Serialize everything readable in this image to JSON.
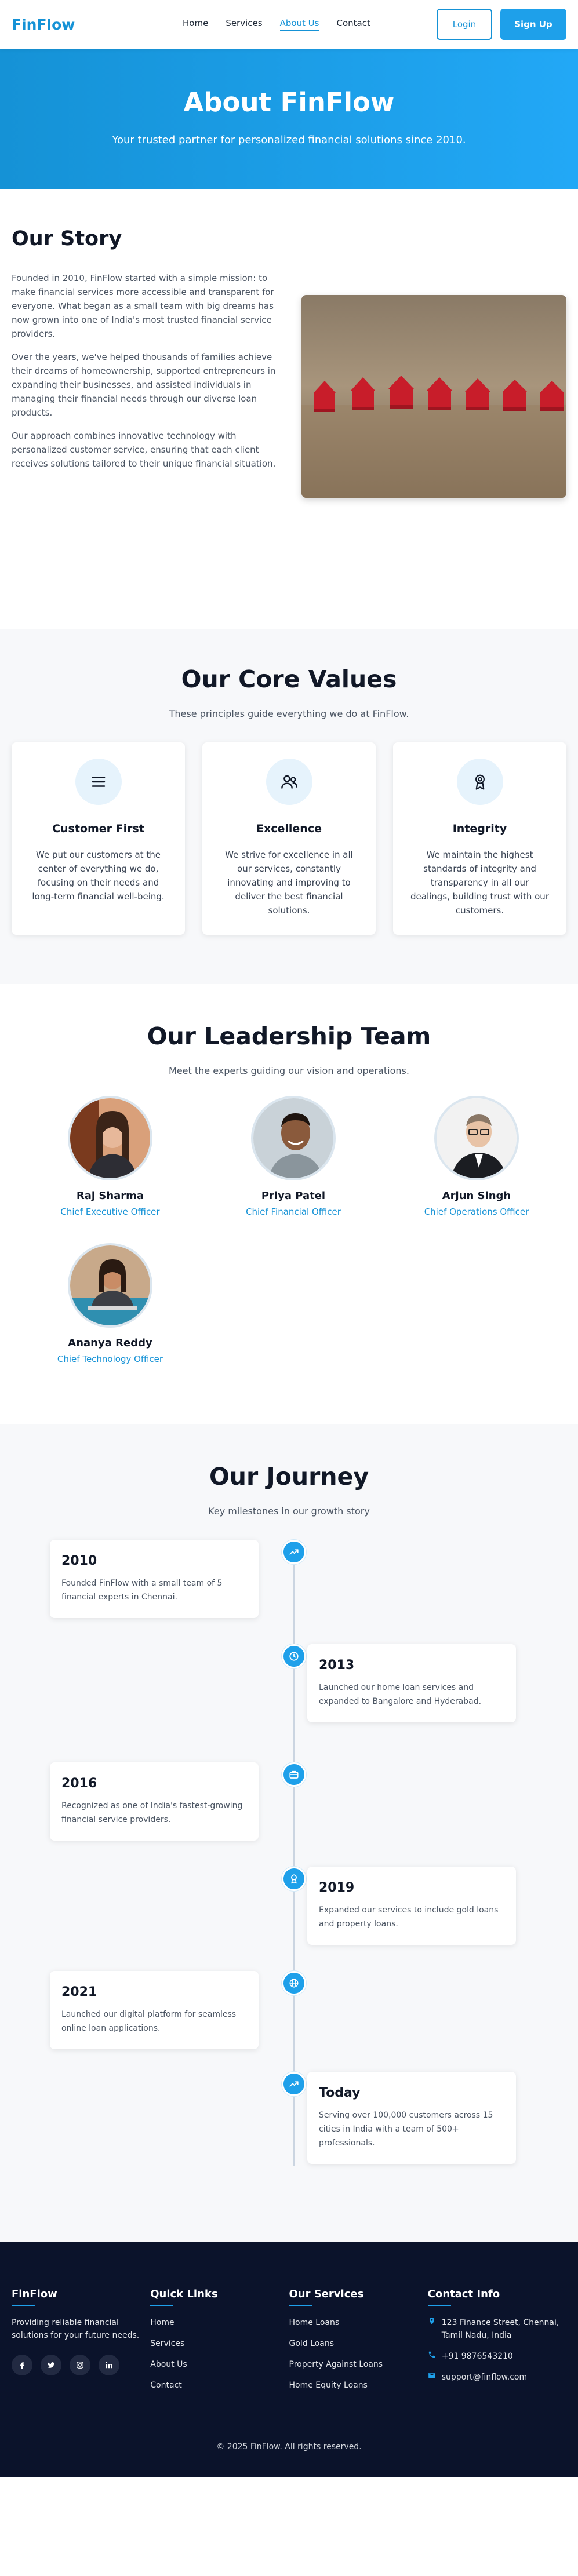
{
  "header": {
    "logo": "FinFlow",
    "nav": [
      "Home",
      "Services",
      "About Us",
      "Contact"
    ],
    "login": "Login",
    "signup": "Sign Up"
  },
  "hero": {
    "title": "About FinFlow",
    "subtitle": "Your trusted partner for personalized financial solutions since 2010."
  },
  "story": {
    "title": "Our Story",
    "paragraphs": [
      "Founded in 2010, FinFlow started with a simple mission: to make financial services more accessible and transparent for everyone. What began as a small team with big dreams has now grown into one of India's most trusted financial service providers.",
      "Over the years, we've helped thousands of families achieve their dreams of homeownership, supported entrepreneurs in expanding their businesses, and assisted individuals in managing their financial needs through our diverse loan products.",
      "Our approach combines innovative technology with personalized customer service, ensuring that each client receives solutions tailored to their unique financial situation."
    ]
  },
  "values": {
    "title": "Our Core Values",
    "subtitle": "These principles guide everything we do at FinFlow.",
    "cards": [
      {
        "icon": "menu-icon",
        "title": "Customer First",
        "text": "We put our customers at the center of everything we do, focusing on their needs and long-term financial well-being."
      },
      {
        "icon": "users-icon",
        "title": "Excellence",
        "text": "We strive for excellence in all our services, constantly innovating and improving to deliver the best financial solutions."
      },
      {
        "icon": "award-icon",
        "title": "Integrity",
        "text": "We maintain the highest standards of integrity and transparency in all our dealings, building trust with our customers."
      }
    ]
  },
  "team": {
    "title": "Our Leadership Team",
    "subtitle": "Meet the experts guiding our vision and operations.",
    "members": [
      {
        "name": "Raj Sharma",
        "role": "Chief Executive Officer"
      },
      {
        "name": "Priya Patel",
        "role": "Chief Financial Officer"
      },
      {
        "name": "Arjun Singh",
        "role": "Chief Operations Officer"
      },
      {
        "name": "Ananya Reddy",
        "role": "Chief Technology Officer"
      }
    ]
  },
  "journey": {
    "title": "Our Journey",
    "subtitle": "Key milestones in our growth story",
    "milestones": [
      {
        "year": "2010",
        "text": "Founded FinFlow with a small team of 5 financial experts in Chennai.",
        "icon": "trend-icon"
      },
      {
        "year": "2013",
        "text": "Launched our home loan services and expanded to Bangalore and Hyderabad.",
        "icon": "clock-icon"
      },
      {
        "year": "2016",
        "text": "Recognized as one of India's fastest-growing financial service providers.",
        "icon": "briefcase-icon"
      },
      {
        "year": "2019",
        "text": "Expanded our services to include gold loans and property loans.",
        "icon": "award-icon"
      },
      {
        "year": "2021",
        "text": "Launched our digital platform for seamless online loan applications.",
        "icon": "globe-icon"
      },
      {
        "year": "Today",
        "text": "Serving over 100,000 customers across 15 cities in India with a team of 500+ professionals.",
        "icon": "trend-icon"
      }
    ]
  },
  "footer": {
    "brand": "FinFlow",
    "tagline": "Providing reliable financial solutions for your future needs.",
    "quick_links_title": "Quick Links",
    "quick_links": [
      "Home",
      "Services",
      "About Us",
      "Contact"
    ],
    "services_title": "Our Services",
    "services": [
      "Home Loans",
      "Gold Loans",
      "Property Against Loans",
      "Home Equity Loans"
    ],
    "contact_title": "Contact Info",
    "address": "123 Finance Street, Chennai, Tamil Nadu, India",
    "phone": "+91 9876543210",
    "email": "support@finflow.com",
    "copyright": "© 2025 FinFlow. All rights reserved."
  },
  "colors": {
    "primary": "#1592d6",
    "accent": "#1ea0ea",
    "footer_bg": "#0b132b",
    "section_bg": "#f7f8fa"
  }
}
